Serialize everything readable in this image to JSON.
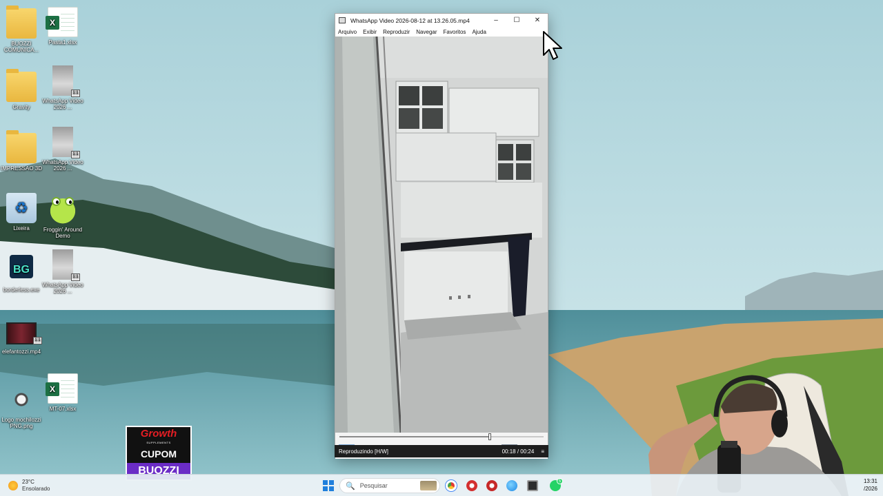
{
  "desktop": {
    "icons": [
      {
        "label": "BUOZZI COMUNICA...",
        "icon": "folder-icon"
      },
      {
        "label": "Pasta1.xlsx",
        "icon": "excel-file-icon"
      },
      {
        "label": "Gravity",
        "icon": "folder-icon"
      },
      {
        "label": "WhatsApp Video 2026 ...",
        "icon": "video-file-icon"
      },
      {
        "label": "IMPRESSAO 3D",
        "icon": "folder-icon"
      },
      {
        "label": "WhatsApp Video 2026 ...",
        "icon": "video-file-icon"
      },
      {
        "label": "Lixeira",
        "icon": "recycle-bin-icon"
      },
      {
        "label": "Froggin' Around Demo",
        "icon": "frog-game-icon"
      },
      {
        "label": "borderless.exe",
        "icon": "bg-app-icon"
      },
      {
        "label": "WhatsApp Video 2026 ...",
        "icon": "video-file-icon"
      },
      {
        "label": "elefantozzi.mp4",
        "icon": "mp4-file-icon"
      },
      {
        "label": "Logo mochilozzi PNG.png",
        "icon": "png-file-icon"
      },
      {
        "label": "MT-07.xlsx",
        "icon": "excel-file-icon"
      }
    ],
    "excel_glyph": "X",
    "bg_glyph": "BG",
    "vlc_glyph": "1:1"
  },
  "player": {
    "title": "WhatsApp Video 2026-08-12 at 13.26.05.mp4",
    "window_buttons": {
      "minimize": "–",
      "maximize": "☐",
      "close": "✕"
    },
    "menu": [
      "Arquivo",
      "Exibir",
      "Reproduzir",
      "Navegar",
      "Favoritos",
      "Ajuda"
    ],
    "progress": 0.735,
    "controls": {
      "play": "▶",
      "pause": "❚❚",
      "stop": "■",
      "prev": "⏮",
      "rewind": "◀◀",
      "forward": "▶▶",
      "next": "⏭",
      "frame_step": "▶❚",
      "mute": "🔇"
    },
    "status": "Reproduzindo [H/W]",
    "time": "00:18 / 00:24",
    "status_icon": "≡"
  },
  "promo": {
    "brand": "Growth",
    "sub": "SUPPLEMENTS",
    "cupom": "CUPOM",
    "code": "BUOZZI"
  },
  "taskbar": {
    "weather_temp": "23°C",
    "weather_condition": "Ensolarado",
    "search_placeholder": "Pesquisar",
    "search_icon": "🔍",
    "clock_time": "13:31",
    "clock_date": "/2026",
    "pinned_apps": [
      "chrome-icon",
      "opera-icon",
      "opera-icon",
      "edge-like-icon",
      "media-player-icon",
      "whatsapp-icon"
    ],
    "whatsapp_badge": "5"
  },
  "colors": {
    "accent": "#1f7fdc",
    "titlebar": "#ffffff",
    "status_bar": "#1e1e1e",
    "promo_purple": "#6b2cc6",
    "promo_red": "#e41e24"
  }
}
